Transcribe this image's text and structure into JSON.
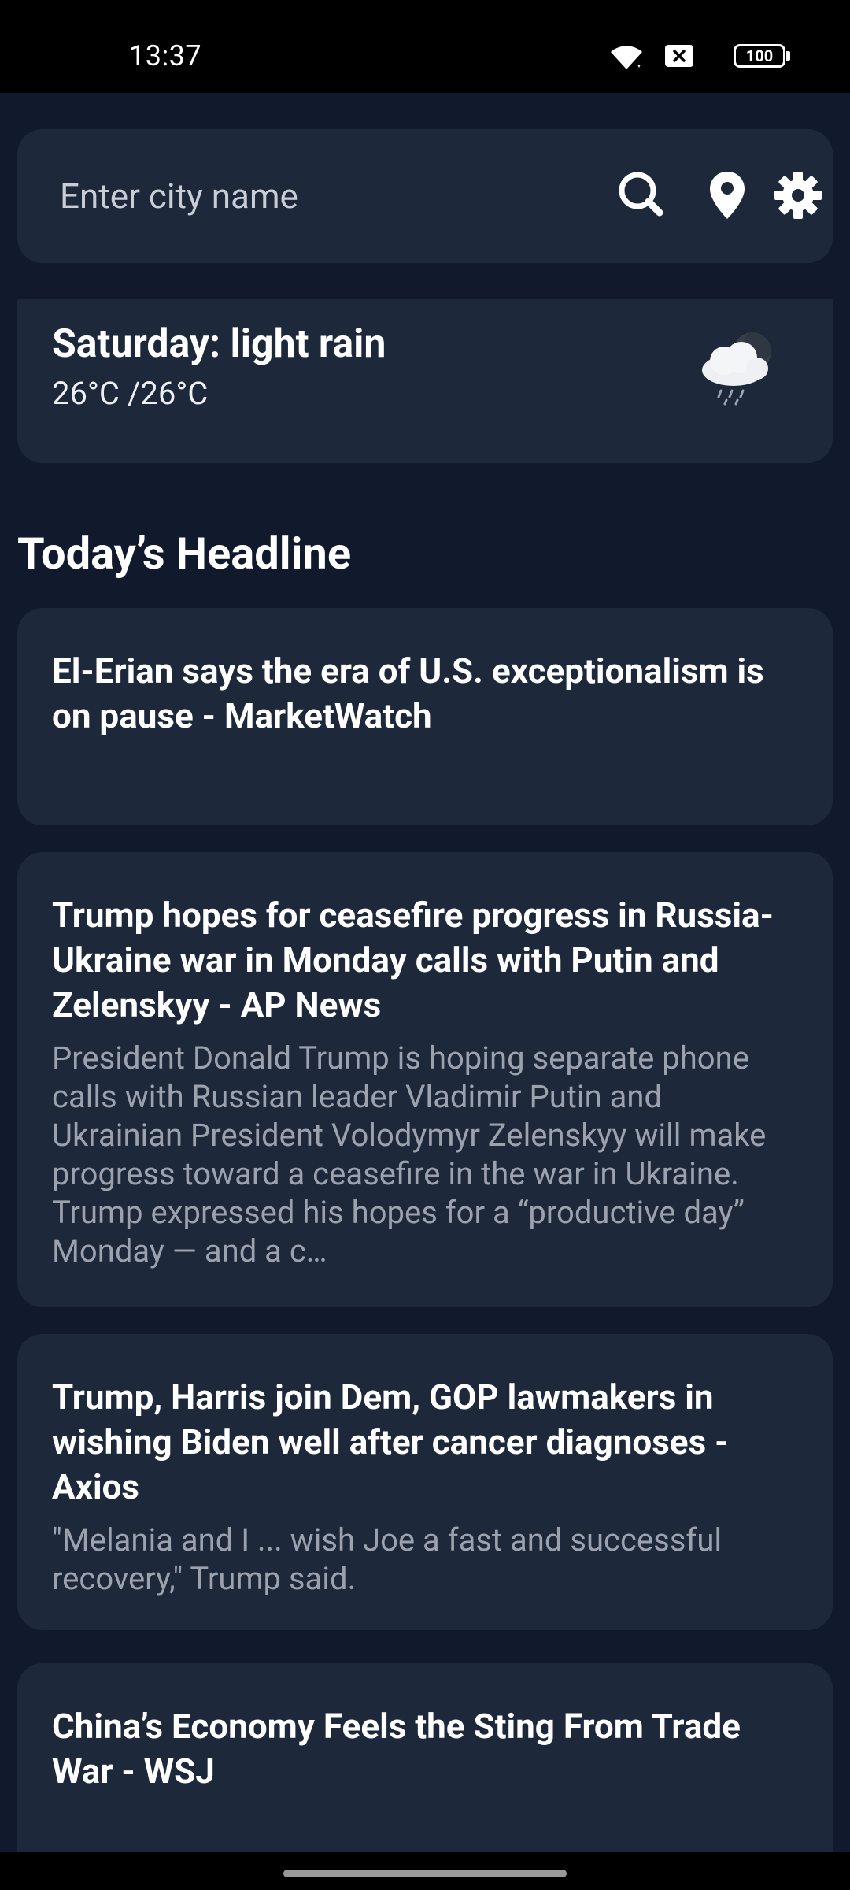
{
  "status_bar": {
    "time": "13:37",
    "battery": "100",
    "icons": [
      "wifi-icon",
      "notification-x-icon",
      "battery-icon"
    ]
  },
  "search": {
    "placeholder": "Enter city name",
    "value": "",
    "icons": [
      "search-icon",
      "location-pin-icon",
      "gear-icon"
    ]
  },
  "weather": {
    "day": "Saturday: light rain",
    "temp": "26°C /26°C",
    "icon": "light-rain-cloud-icon"
  },
  "headlines_title": "Today’s Headline",
  "news": [
    {
      "title": "El-Erian says the era of U.S. exceptionalism is on pause - MarketWatch",
      "description": ""
    },
    {
      "title": "Trump hopes for ceasefire progress in Russia-Ukraine war in Monday calls with Putin and Zelenskyy - AP News",
      "description": "President Donald Trump is hoping separate phone calls with Russian leader Vladimir Putin and Ukrainian President Volodymyr Zelenskyy will make progress toward a ceasefire in the war in Ukraine. Trump expressed his hopes for a “productive day” Monday — and a c…"
    },
    {
      "title": "Trump, Harris join Dem, GOP lawmakers in wishing Biden well after cancer diagnoses - Axios",
      "description": "\"Melania and I ... wish Joe a fast and successful recovery,\" Trump said."
    },
    {
      "title": "China’s Economy Feels the Sting From Trade War - WSJ",
      "description": ""
    }
  ],
  "colors": {
    "background": "#111a2c",
    "card": "#1e283b",
    "text_primary": "#ffffff",
    "text_secondary": "#9ba1ad"
  }
}
